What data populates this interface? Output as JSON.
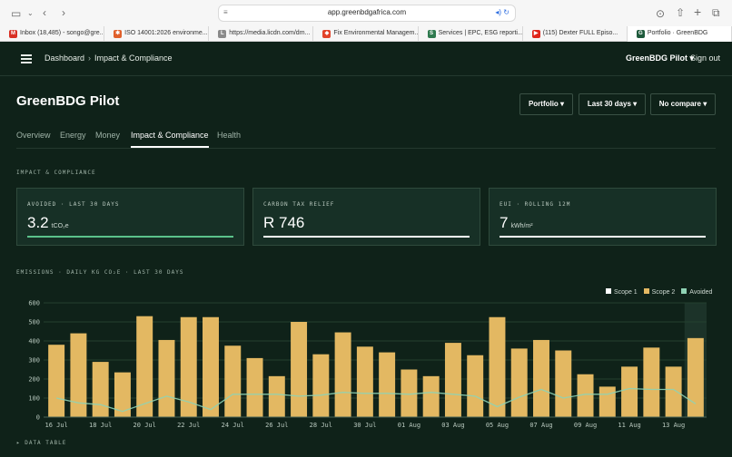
{
  "browser": {
    "url": "app.greenbdgafrica.com",
    "tabs": [
      {
        "label": "Inbox (18,485) - songo@gre...",
        "icon": "gmail-icon",
        "color": "#d93025",
        "glyph": "M"
      },
      {
        "label": "ISO 14001:2026 environme...",
        "icon": "iso-icon",
        "color": "#e0602b",
        "glyph": "✱"
      },
      {
        "label": "https://media.licdn.com/dm...",
        "icon": "link-icon",
        "color": "#8a8a8a",
        "glyph": "L"
      },
      {
        "label": "Fix Environmental Managem...",
        "icon": "gitlab-icon",
        "color": "#e2432a",
        "glyph": "◆"
      },
      {
        "label": "Services | EPC, ESG reporti...",
        "icon": "services-icon",
        "color": "#2f7a4f",
        "glyph": "S"
      },
      {
        "label": "(115) Dexter FULL Episo...",
        "icon": "youtube-icon",
        "color": "#e0261c",
        "glyph": "▶"
      },
      {
        "label": "Portfolio · GreenBDG",
        "icon": "greenbdg-icon",
        "color": "#1f5a3c",
        "glyph": "G"
      }
    ]
  },
  "header": {
    "breadcrumb_home": "Dashboard",
    "breadcrumb_sep": "›",
    "breadcrumb_current": "Impact & Compliance",
    "account": "GreenBDG Pilot ▾",
    "signout": "Sign out"
  },
  "page": {
    "title": "GreenBDG Pilot",
    "filters": [
      "Portfolio ▾",
      "Last 30 days ▾",
      "No compare ▾"
    ],
    "tabs": [
      "Overview",
      "Energy",
      "Money",
      "Impact & Compliance",
      "Health"
    ],
    "active_tab": 3,
    "section_label": "IMPACT & COMPLIANCE"
  },
  "kpis": [
    {
      "label": "AVOIDED · LAST 30 DAYS",
      "value": "3.2",
      "unit": "tCO₂e"
    },
    {
      "label": "CARBON TAX RELIEF",
      "value": "R 746",
      "unit": ""
    },
    {
      "label": "EUI · ROLLING 12M",
      "value": "7",
      "unit": "kWh/m²"
    }
  ],
  "colors": {
    "background": "#0f2219",
    "scope1": "#ffffff",
    "scope2": "#e3b862",
    "avoided": "#8fd3b4",
    "accent_green": "#5bc28b"
  },
  "chart_label": "EMISSIONS · DAILY KG CO₂E · LAST 30 DAYS",
  "data_table_toggle": "▸ DATA TABLE",
  "chart_data": {
    "type": "bar",
    "title": "EMISSIONS · DAILY KG CO₂E · LAST 30 DAYS",
    "x_tick_labels": [
      "16 Jul",
      "18 Jul",
      "20 Jul",
      "22 Jul",
      "24 Jul",
      "26 Jul",
      "28 Jul",
      "30 Jul",
      "01 Aug",
      "03 Aug",
      "05 Aug",
      "07 Aug",
      "09 Aug",
      "11 Aug",
      "13 Aug"
    ],
    "categories": [
      "16 Jul",
      "17 Jul",
      "18 Jul",
      "19 Jul",
      "20 Jul",
      "21 Jul",
      "22 Jul",
      "23 Jul",
      "24 Jul",
      "25 Jul",
      "26 Jul",
      "27 Jul",
      "28 Jul",
      "29 Jul",
      "30 Jul",
      "31 Jul",
      "01 Aug",
      "02 Aug",
      "03 Aug",
      "04 Aug",
      "05 Aug",
      "06 Aug",
      "07 Aug",
      "08 Aug",
      "09 Aug",
      "10 Aug",
      "11 Aug",
      "12 Aug",
      "13 Aug",
      "14 Aug"
    ],
    "ylim": [
      0,
      600
    ],
    "y_ticks": [
      0,
      100,
      200,
      300,
      400,
      500,
      600
    ],
    "legend": [
      "Scope 1",
      "Scope 2",
      "Avoided"
    ],
    "legend_position": "top-right",
    "grid": true,
    "series": [
      {
        "name": "Scope 1",
        "type": "bar",
        "values": [
          0,
          0,
          0,
          0,
          0,
          0,
          0,
          0,
          0,
          0,
          0,
          0,
          0,
          0,
          0,
          0,
          0,
          0,
          0,
          0,
          0,
          0,
          0,
          0,
          0,
          0,
          0,
          0,
          0,
          0
        ]
      },
      {
        "name": "Scope 2",
        "type": "bar",
        "values": [
          380,
          440,
          290,
          235,
          530,
          405,
          525,
          525,
          375,
          310,
          215,
          500,
          330,
          445,
          370,
          340,
          250,
          215,
          390,
          325,
          525,
          360,
          405,
          350,
          225,
          160,
          265,
          365,
          265,
          415
        ]
      },
      {
        "name": "Avoided",
        "type": "line",
        "values": [
          100,
          75,
          65,
          30,
          70,
          110,
          80,
          40,
          120,
          120,
          120,
          110,
          115,
          130,
          125,
          125,
          120,
          130,
          120,
          110,
          55,
          105,
          145,
          100,
          120,
          120,
          150,
          145,
          145,
          70
        ]
      }
    ]
  }
}
